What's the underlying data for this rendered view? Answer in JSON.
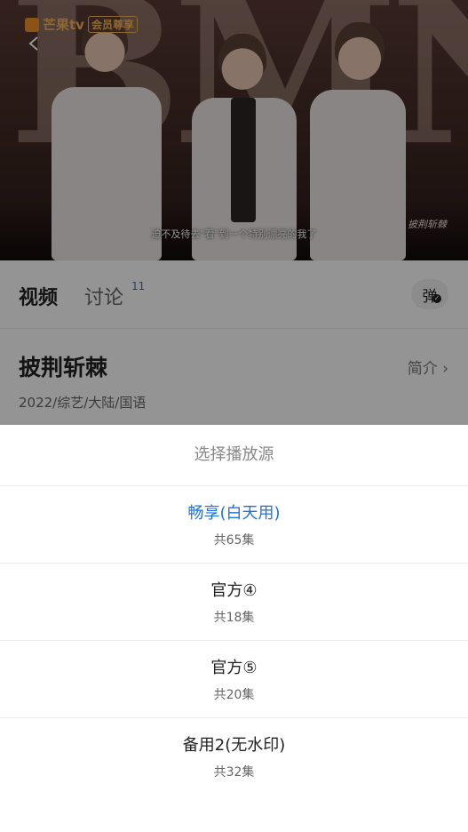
{
  "player": {
    "logo_brand": "芒果tv",
    "logo_badge": "会员尊享",
    "subtitle": "迫不及待去\"看\"到一个特别漂亮的我了",
    "corner_badge": "披荆斩棘"
  },
  "tabs": {
    "video_label": "视频",
    "discuss_label": "讨论",
    "discuss_count": "11",
    "danmu_label": "弹"
  },
  "show": {
    "title": "披荆斩棘",
    "intro_label": "简介 ›",
    "meta": "2022/综艺/大陆/国语"
  },
  "source_sheet": {
    "title": "选择播放源",
    "accent_color": "#1f73d6",
    "sources": [
      {
        "name": "畅享(白天用)",
        "episodes": "共65集",
        "selected": true
      },
      {
        "name": "官方④",
        "episodes": "共18集",
        "selected": false
      },
      {
        "name": "官方⑤",
        "episodes": "共20集",
        "selected": false
      },
      {
        "name": "备用2(无水印)",
        "episodes": "共32集",
        "selected": false
      }
    ]
  }
}
